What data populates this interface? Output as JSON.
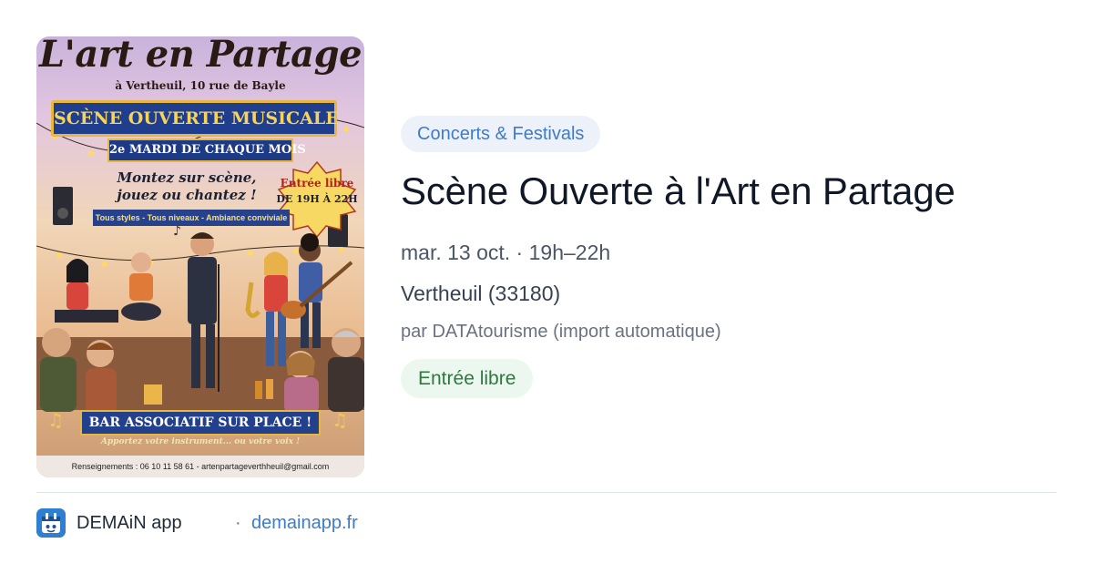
{
  "poster": {
    "title": "L'art en Partage",
    "address": "à Vertheuil, 10 rue de Bayle",
    "banner": "SCÈNE OUVERTE MUSICALE",
    "schedule": "2e MARDI DE CHAQUE MOIS",
    "invite": "Montez sur scène,\njouez ou chantez !",
    "styles": "Tous styles - Tous niveaux - Ambiance conviviale",
    "entry_line1": "Entrée libre",
    "entry_line2": "DE 19H À 22H",
    "bar": "BAR ASSOCIATIF SUR PLACE !",
    "bring": "Apportez votre instrument... ou votre voix !",
    "contact": "Renseignements : 06 10 11 58 61 - artenpartageverthheuil@gmail.com"
  },
  "event": {
    "category": "Concerts & Festivals",
    "title": "Scène Ouverte à l'Art en Partage",
    "datetime": "mar. 13 oct. · 19h–22h",
    "location": "Vertheuil (33180)",
    "source": "par DATAtourisme (import automatique)",
    "price": "Entrée libre"
  },
  "footer": {
    "app_name": "DEMAiN app",
    "separator": "·",
    "link": "demainapp.fr"
  },
  "colors": {
    "accent_blue": "#3e7bc8",
    "tag_bg": "#edf2fa",
    "price_green": "#2c7a3f",
    "price_bg": "#ecf8ef",
    "title": "#101828"
  }
}
